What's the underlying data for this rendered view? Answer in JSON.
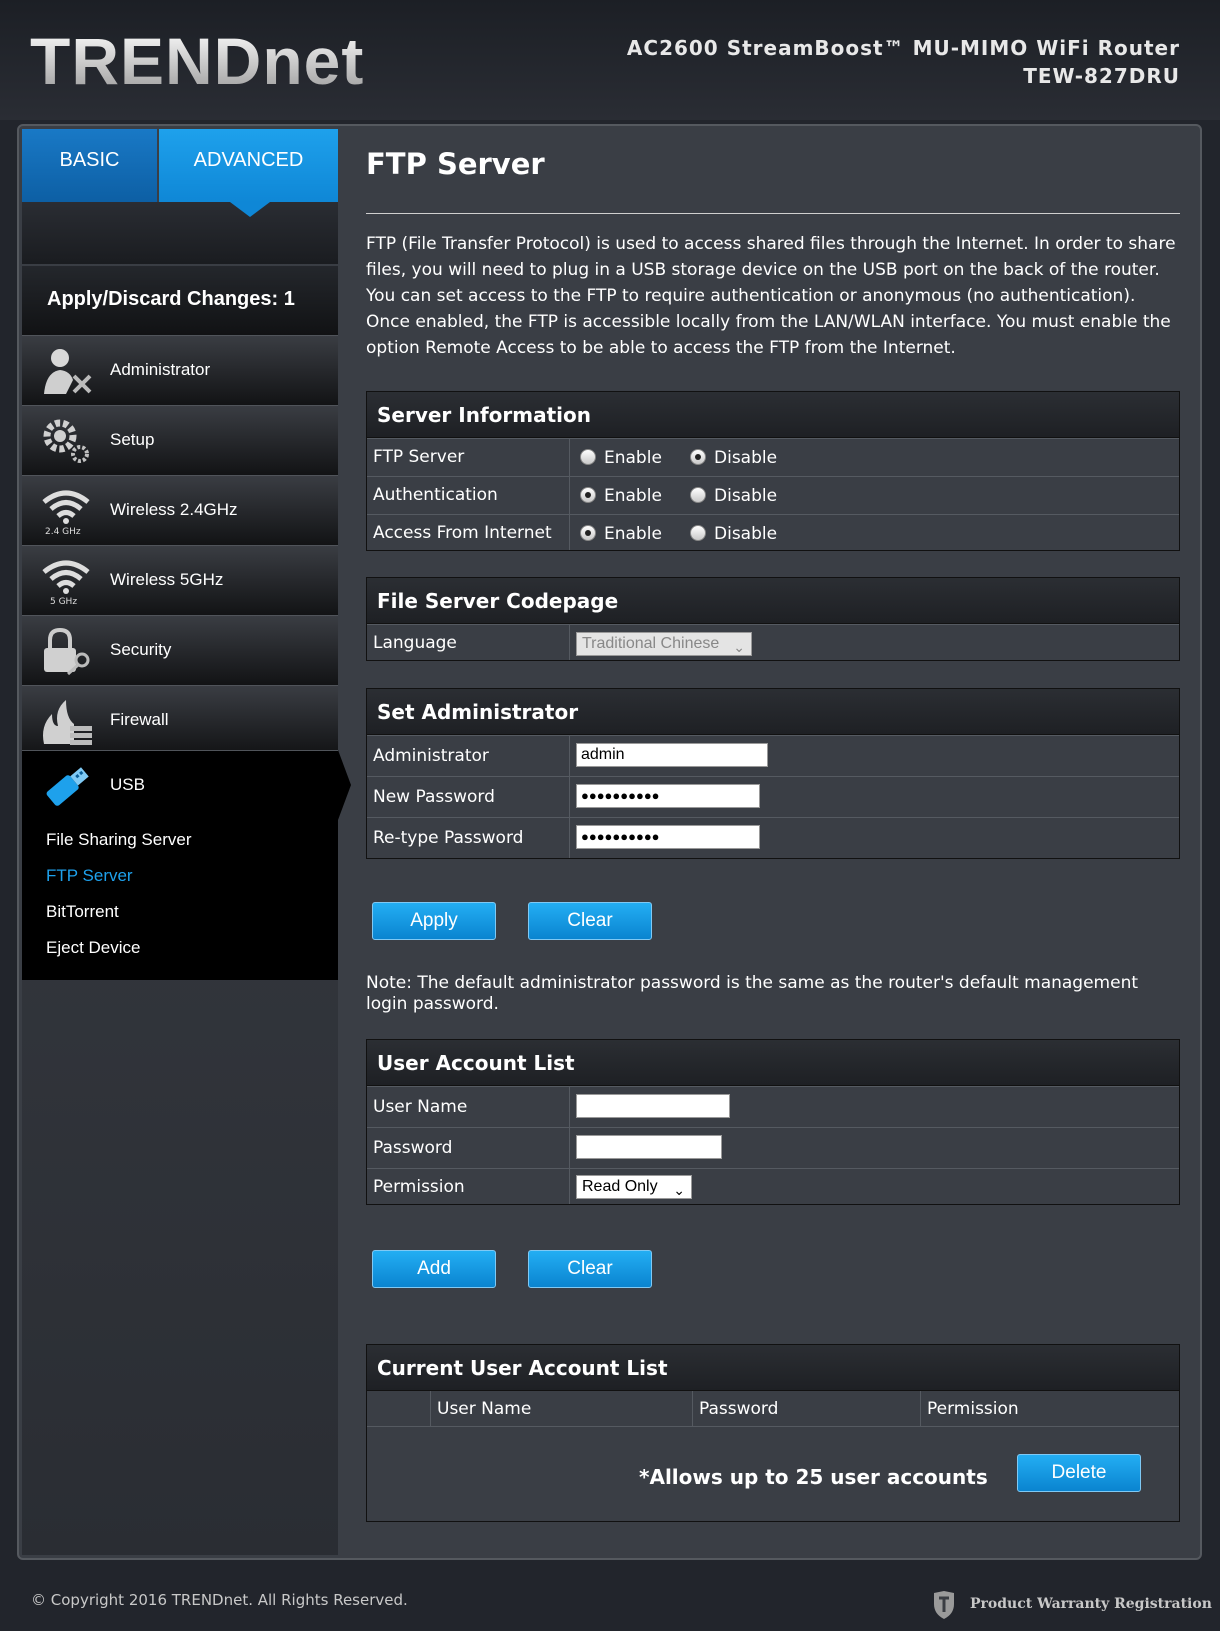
{
  "header": {
    "logo": "TRENDnet",
    "product_line1": "AC2600 StreamBoost™ MU-MIMO WiFi Router",
    "product_line2": "TEW-827DRU"
  },
  "tabs": {
    "basic": "BASIC",
    "advanced": "ADVANCED"
  },
  "apply_changes": "Apply/Discard Changes: 1",
  "menu": {
    "administrator": "Administrator",
    "setup": "Setup",
    "wireless24": "Wireless 2.4GHz",
    "wireless24_badge": "2.4 GHz",
    "wireless5": "Wireless 5GHz",
    "wireless5_badge": "5 GHz",
    "security": "Security",
    "firewall": "Firewall",
    "usb": "USB"
  },
  "usb_submenu": {
    "file_sharing": "File Sharing Server",
    "ftp": "FTP Server",
    "bittorrent": "BitTorrent",
    "eject": "Eject Device"
  },
  "page": {
    "title": "FTP Server",
    "description": "FTP (File Transfer Protocol) is used to access shared files through the Internet. In order to share files, you will need to plug in a USB storage device on the USB port on the back of the router. You can set access to the FTP to require authentication or anonymous (no authentication). Once enabled, the FTP is accessible locally from the LAN/WLAN interface. You must enable the option Remote Access to be able to access the FTP from the Internet."
  },
  "server_info": {
    "title": "Server Information",
    "enable": "Enable",
    "disable": "Disable",
    "ftp_server": {
      "label": "FTP Server",
      "selected": "Disable"
    },
    "authentication": {
      "label": "Authentication",
      "selected": "Enable"
    },
    "access_internet": {
      "label": "Access From Internet",
      "selected": "Enable"
    }
  },
  "codepage": {
    "title": "File Server Codepage",
    "language_label": "Language",
    "language_value": "Traditional Chinese"
  },
  "set_admin": {
    "title": "Set Administrator",
    "admin_label": "Administrator",
    "admin_value": "admin",
    "new_pw_label": "New Password",
    "new_pw_value": "●●●●●●●●●●",
    "retype_label": "Re-type Password",
    "retype_value": "●●●●●●●●●●"
  },
  "buttons": {
    "apply": "Apply",
    "clear": "Clear",
    "add": "Add",
    "delete": "Delete"
  },
  "note": "Note: The default administrator password is the same as the router's default management login password.",
  "user_list": {
    "title": "User Account List",
    "username_label": "User Name",
    "password_label": "Password",
    "permission_label": "Permission",
    "permission_value": "Read Only"
  },
  "current_list": {
    "title": "Current User Account List",
    "col_user": "User Name",
    "col_password": "Password",
    "col_permission": "Permission",
    "limit_note": "*Allows up to 25 user accounts"
  },
  "footer": {
    "copyright": "© Copyright 2016 TRENDnet. All Rights Reserved.",
    "warranty": "Product Warranty Registration"
  },
  "colors": {
    "accent": "#1ea1ec",
    "tab_basic": "#0d5fa4",
    "background": "#22252c"
  }
}
